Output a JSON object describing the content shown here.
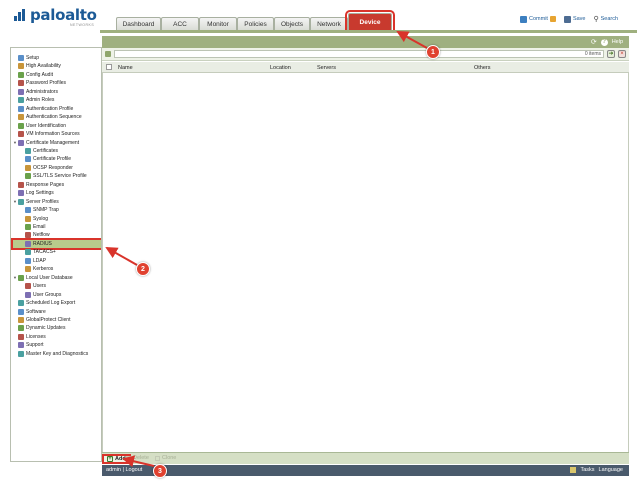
{
  "brand": {
    "name": "paloalto",
    "sub": "NETWORKS"
  },
  "tabs": [
    {
      "label": "Dashboard",
      "active": false
    },
    {
      "label": "ACC",
      "active": false
    },
    {
      "label": "Monitor",
      "active": false
    },
    {
      "label": "Policies",
      "active": false
    },
    {
      "label": "Objects",
      "active": false
    },
    {
      "label": "Network",
      "active": false
    },
    {
      "label": "Device",
      "active": true
    }
  ],
  "toolbar": {
    "commit": "Commit",
    "save": "Save",
    "search": "Search"
  },
  "main": {
    "help": "Help",
    "items_count": "0 items"
  },
  "columns": [
    "Name",
    "Location",
    "Servers",
    "Others"
  ],
  "nav": [
    {
      "label": "Setup",
      "icon": "gear-icon",
      "indent": 0,
      "twisty": ""
    },
    {
      "label": "High Availability",
      "icon": "ha-icon",
      "indent": 0,
      "twisty": ""
    },
    {
      "label": "Config Audit",
      "icon": "audit-icon",
      "indent": 0,
      "twisty": ""
    },
    {
      "label": "Password Profiles",
      "icon": "key-icon",
      "indent": 0,
      "twisty": ""
    },
    {
      "label": "Administrators",
      "icon": "admin-icon",
      "indent": 0,
      "twisty": ""
    },
    {
      "label": "Admin Roles",
      "icon": "role-icon",
      "indent": 0,
      "twisty": ""
    },
    {
      "label": "Authentication Profile",
      "icon": "auth-profile-icon",
      "indent": 0,
      "twisty": ""
    },
    {
      "label": "Authentication Sequence",
      "icon": "auth-sequence-icon",
      "indent": 0,
      "twisty": ""
    },
    {
      "label": "User Identification",
      "icon": "user-id-icon",
      "indent": 0,
      "twisty": ""
    },
    {
      "label": "VM Information Sources",
      "icon": "vm-icon",
      "indent": 0,
      "twisty": ""
    },
    {
      "label": "Certificate Management",
      "icon": "certificate-icon",
      "indent": 0,
      "twisty": "▼"
    },
    {
      "label": "Certificates",
      "icon": "certificate-icon",
      "indent": 1,
      "twisty": ""
    },
    {
      "label": "Certificate Profile",
      "icon": "certificate-profile-icon",
      "indent": 1,
      "twisty": ""
    },
    {
      "label": "OCSP Responder",
      "icon": "ocsp-icon",
      "indent": 1,
      "twisty": ""
    },
    {
      "label": "SSL/TLS Service Profile",
      "icon": "lock-icon",
      "indent": 1,
      "twisty": ""
    },
    {
      "label": "Response Pages",
      "icon": "response-pages-icon",
      "indent": 0,
      "twisty": ""
    },
    {
      "label": "Log Settings",
      "icon": "log-icon",
      "indent": 0,
      "twisty": ""
    },
    {
      "label": "Server Profiles",
      "icon": "server-profile-icon",
      "indent": 0,
      "twisty": "▼"
    },
    {
      "label": "SNMP Trap",
      "icon": "snmp-icon",
      "indent": 1,
      "twisty": ""
    },
    {
      "label": "Syslog",
      "icon": "syslog-icon",
      "indent": 1,
      "twisty": ""
    },
    {
      "label": "Email",
      "icon": "email-icon",
      "indent": 1,
      "twisty": ""
    },
    {
      "label": "Netflow",
      "icon": "netflow-icon",
      "indent": 1,
      "twisty": ""
    },
    {
      "label": "RADIUS",
      "icon": "radius-icon",
      "indent": 1,
      "twisty": "",
      "selected": true
    },
    {
      "label": "TACACS+",
      "icon": "tacacs-icon",
      "indent": 1,
      "twisty": ""
    },
    {
      "label": "LDAP",
      "icon": "ldap-icon",
      "indent": 1,
      "twisty": ""
    },
    {
      "label": "Kerberos",
      "icon": "kerberos-icon",
      "indent": 1,
      "twisty": ""
    },
    {
      "label": "Local User Database",
      "icon": "user-db-icon",
      "indent": 0,
      "twisty": "▼"
    },
    {
      "label": "Users",
      "icon": "user-icon",
      "indent": 1,
      "twisty": ""
    },
    {
      "label": "User Groups",
      "icon": "user-group-icon",
      "indent": 1,
      "twisty": ""
    },
    {
      "label": "Scheduled Log Export",
      "icon": "export-icon",
      "indent": 0,
      "twisty": ""
    },
    {
      "label": "Software",
      "icon": "software-icon",
      "indent": 0,
      "twisty": ""
    },
    {
      "label": "GlobalProtect Client",
      "icon": "globalprotect-icon",
      "indent": 0,
      "twisty": ""
    },
    {
      "label": "Dynamic Updates",
      "icon": "update-icon",
      "indent": 0,
      "twisty": ""
    },
    {
      "label": "Licenses",
      "icon": "license-icon",
      "indent": 0,
      "twisty": ""
    },
    {
      "label": "Support",
      "icon": "support-icon",
      "indent": 0,
      "twisty": ""
    },
    {
      "label": "Master Key and Diagnostics",
      "icon": "master-key-icon",
      "indent": 0,
      "twisty": ""
    }
  ],
  "actions": {
    "add": "Add",
    "delete": "Delete",
    "clone": "Clone"
  },
  "footer": {
    "user": "admin",
    "logout": "Logout",
    "tasks": "Tasks",
    "language": "Language"
  },
  "callouts": [
    "1",
    "2",
    "3"
  ],
  "colors": {
    "accent": "#9fb07f",
    "active_tab": "#c83a2e",
    "callout": "#e0412f",
    "footer": "#4a5a6c"
  }
}
